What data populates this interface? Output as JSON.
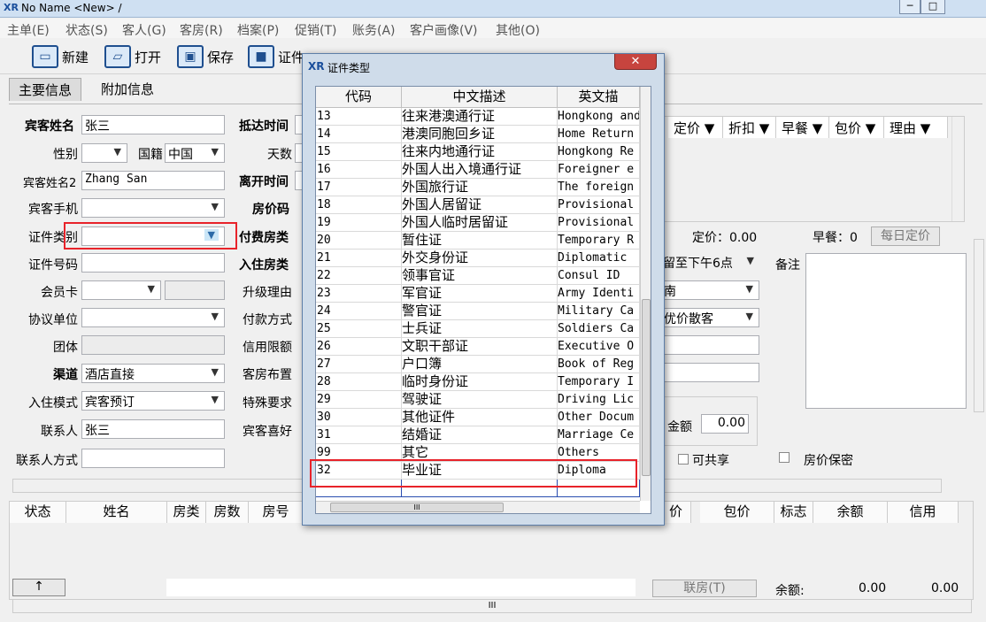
{
  "window": {
    "title": "No Name <New> /",
    "logo": "XR",
    "minimize": "─",
    "maximize": "□"
  },
  "menu": [
    "主单(E)",
    "状态(S)",
    "客人(G)",
    "客房(R)",
    "档案(P)",
    "促销(T)",
    "账务(A)",
    "客户画像(V)",
    "其他(O)"
  ],
  "toolbar": {
    "new": "新建",
    "open": "打开",
    "save": "保存",
    "cert": "证件"
  },
  "tabs": {
    "main": "主要信息",
    "extra": "附加信息"
  },
  "form": {
    "guest_name_label": "宾客姓名",
    "guest_name": "张三",
    "gender_label": "性别",
    "nationality_label": "国籍",
    "nationality": "中国",
    "guest_name2_label": "宾客姓名2",
    "guest_name2": "Zhang San",
    "mobile_label": "宾客手机",
    "id_type_label": "证件类别",
    "id_no_label": "证件号码",
    "member_label": "会员卡",
    "agreement_label": "协议单位",
    "group_label": "团体",
    "channel_label": "渠道",
    "channel": "酒店直接",
    "checkin_mode_label": "入住模式",
    "checkin_mode": "宾客预订",
    "contact_label": "联系人",
    "contact": "张三",
    "contact_method_label": "联系人方式",
    "arrival_label": "抵达时间",
    "days_label": "天数",
    "departure_label": "离开时间",
    "rate_code_label": "房价码",
    "paid_room_label": "付费房类",
    "checkin_room_label": "入住房类",
    "upgrade_label": "升级理由",
    "payment_label": "付款方式",
    "credit_label": "信用限额",
    "layout_label": "客房布置",
    "special_label": "特殊要求",
    "preference_label": "宾客喜好"
  },
  "right_panel": {
    "grid_headers": [
      "定价 ▼",
      "折扣 ▼",
      "早餐 ▼",
      "包价 ▼",
      "理由 ▼"
    ],
    "price_text": "定价：0.00",
    "breakfast_text": "早餐：0",
    "daily_price_button": "每日定价",
    "hold_until": "留至下午6点",
    "remark_label": "备注",
    "source": "南",
    "market": "优价散客",
    "amount_label": "金额",
    "amount": "0.00",
    "shareable_label": "可共享",
    "price_secret_label": "房价保密"
  },
  "bottom": {
    "headers": [
      "状态",
      "姓名",
      "房类",
      "房数",
      "房号",
      "价",
      "包价",
      "标志",
      "余额",
      "信用"
    ],
    "up_button": "↑",
    "link_room_button": "联房(T)",
    "balance_label": "余额:",
    "balance1": "0.00",
    "balance2": "0.00",
    "scroll_grip": "III"
  },
  "dialog": {
    "title": "证件类型",
    "logo": "XR",
    "close": "✕",
    "headers": [
      "代码",
      "中文描述",
      "英文描"
    ],
    "rows": [
      {
        "code": "13",
        "cn": "往来港澳通行证",
        "en": "Hongkong and"
      },
      {
        "code": "14",
        "cn": "港澳同胞回乡证",
        "en": "Home Return"
      },
      {
        "code": "15",
        "cn": "往来内地通行证",
        "en": "Hongkong Re"
      },
      {
        "code": "16",
        "cn": "外国人出入境通行证",
        "en": "Foreigner e"
      },
      {
        "code": "17",
        "cn": "外国旅行证",
        "en": "The foreign"
      },
      {
        "code": "18",
        "cn": "外国人居留证",
        "en": "Provisional"
      },
      {
        "code": "19",
        "cn": "外国人临时居留证",
        "en": "Provisional"
      },
      {
        "code": "20",
        "cn": "暂住证",
        "en": "Temporary R"
      },
      {
        "code": "21",
        "cn": "外交身份证",
        "en": "Diplomatic"
      },
      {
        "code": "22",
        "cn": "领事官证",
        "en": "Consul ID"
      },
      {
        "code": "23",
        "cn": "军官证",
        "en": "Army Identi"
      },
      {
        "code": "24",
        "cn": "警官证",
        "en": "Military Ca"
      },
      {
        "code": "25",
        "cn": "士兵证",
        "en": "Soldiers Ca"
      },
      {
        "code": "26",
        "cn": "文职干部证",
        "en": "Executive O"
      },
      {
        "code": "27",
        "cn": "户口簿",
        "en": "Book of Reg"
      },
      {
        "code": "28",
        "cn": "临时身份证",
        "en": "Temporary I"
      },
      {
        "code": "29",
        "cn": "驾驶证",
        "en": "Driving Lic"
      },
      {
        "code": "30",
        "cn": "其他证件",
        "en": "Other Docum"
      },
      {
        "code": "31",
        "cn": "结婚证",
        "en": "Marriage Ce"
      },
      {
        "code": "99",
        "cn": "其它",
        "en": "Others"
      },
      {
        "code": "32",
        "cn": "毕业证",
        "en": "Diploma"
      }
    ],
    "hscroll_grip": "III"
  }
}
